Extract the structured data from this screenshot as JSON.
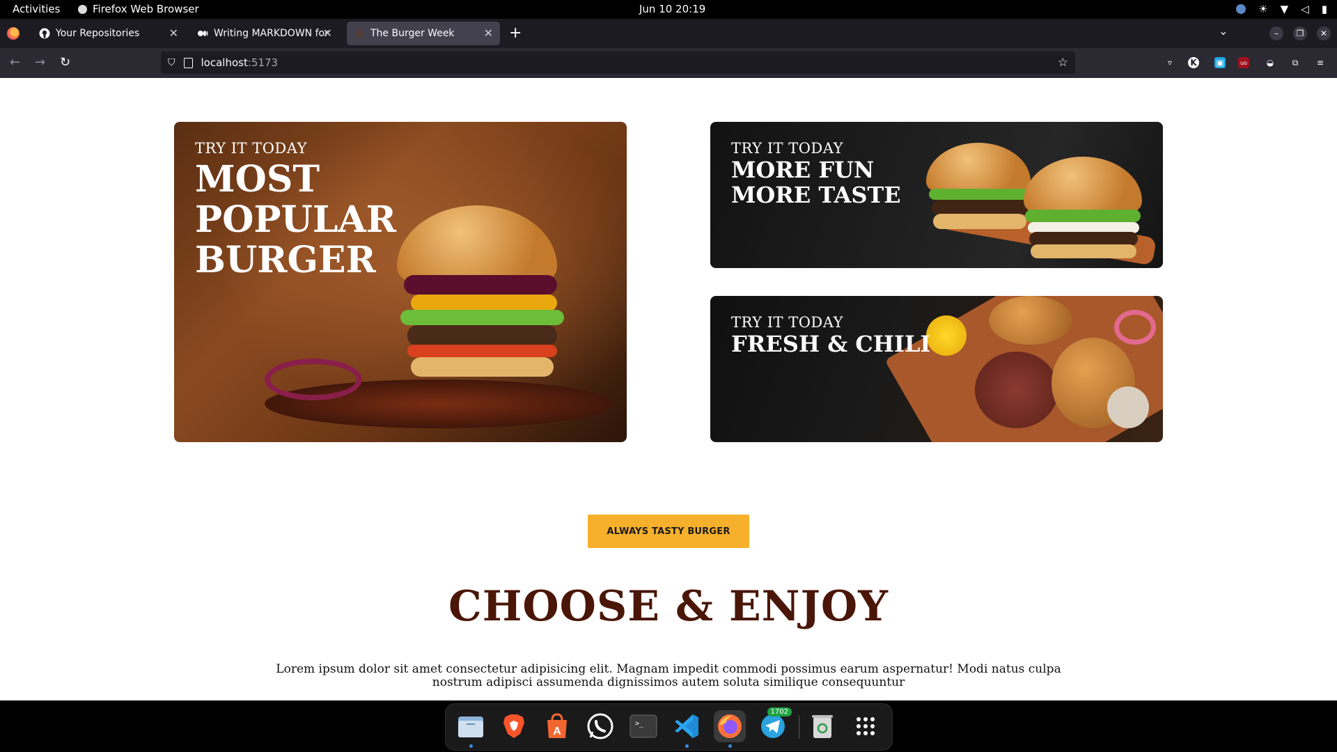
{
  "topbar": {
    "activities": "Activities",
    "app_name": "Firefox Web Browser",
    "clock": "Jun 10  20:19"
  },
  "tabs": [
    {
      "title": "Your Repositories",
      "icon": "github-icon",
      "active": false
    },
    {
      "title": "Writing MARKDOWN for your",
      "icon": "medium-icon",
      "active": false
    },
    {
      "title": "The Burger Week",
      "icon": "burger-favicon",
      "active": true
    }
  ],
  "url": {
    "host": "localhost",
    "port": ":5173"
  },
  "cards": {
    "main": {
      "eyebrow": "TRY IT TODAY",
      "headline": "MOST\nPOPULAR\nBURGER"
    },
    "top": {
      "eyebrow": "TRY IT TODAY",
      "headline": "MORE FUN\nMORE TASTE"
    },
    "bottom": {
      "eyebrow": "TRY IT TODAY",
      "headline": "FRESH & CHILI"
    }
  },
  "cta_label": "ALWAYS TASTY BURGER",
  "section_title": "CHOOSE & ENJOY",
  "lorem": "Lorem ipsum dolor sit amet consectetur adipisicing elit. Magnam impedit commodi possimus earum aspernatur! Modi natus culpa nostrum adipisci assumenda dignissimos autem soluta similique consequuntur",
  "dock": {
    "items": [
      "files-icon",
      "brave-icon",
      "app-center-icon",
      "whatsapp-icon",
      "terminal-icon",
      "vscode-icon",
      "firefox-icon",
      "telegram-icon",
      "trash-icon",
      "app-grid-icon"
    ],
    "telegram_badge": "1702"
  },
  "colors": {
    "accent": "#f6b02c",
    "title": "#4a1607"
  }
}
